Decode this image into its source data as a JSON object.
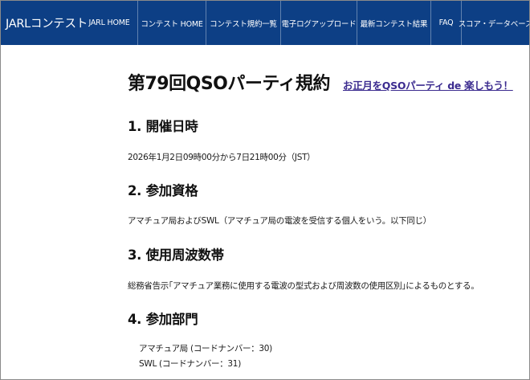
{
  "navbar": {
    "brand": "JARLコンテスト",
    "items": [
      {
        "label": "JARL HOME"
      },
      {
        "label": "コンテスト HOME"
      },
      {
        "label": "コンテスト規約一覧"
      },
      {
        "label": "電子ログアップロード"
      },
      {
        "label": "最新コンテスト結果"
      },
      {
        "label": "FAQ"
      },
      {
        "label": "スコア・データベース"
      }
    ],
    "bg_color": "#0d3f85"
  },
  "main": {
    "title": "第79回QSOパーティ規約",
    "promo_link": "お正月をQSOパーティ de 楽しもう！",
    "sections": [
      {
        "heading": "1. 開催日時",
        "text": "2026年1月2日09時00分から7日21時00分（JST）"
      },
      {
        "heading": "2. 参加資格",
        "text": "アマチュア局およびSWL（アマチュア局の電波を受信する個人をいう。以下同じ）"
      },
      {
        "heading": "3. 使用周波数帯",
        "text": "総務省告示｢アマチュア業務に使用する電波の型式および周波数の使用区別｣によるものとする。"
      },
      {
        "heading": "4. 参加部門",
        "items": [
          "アマチュア局 (コードナンバー：30)",
          "SWL (コードナンバー：31)"
        ]
      }
    ]
  }
}
